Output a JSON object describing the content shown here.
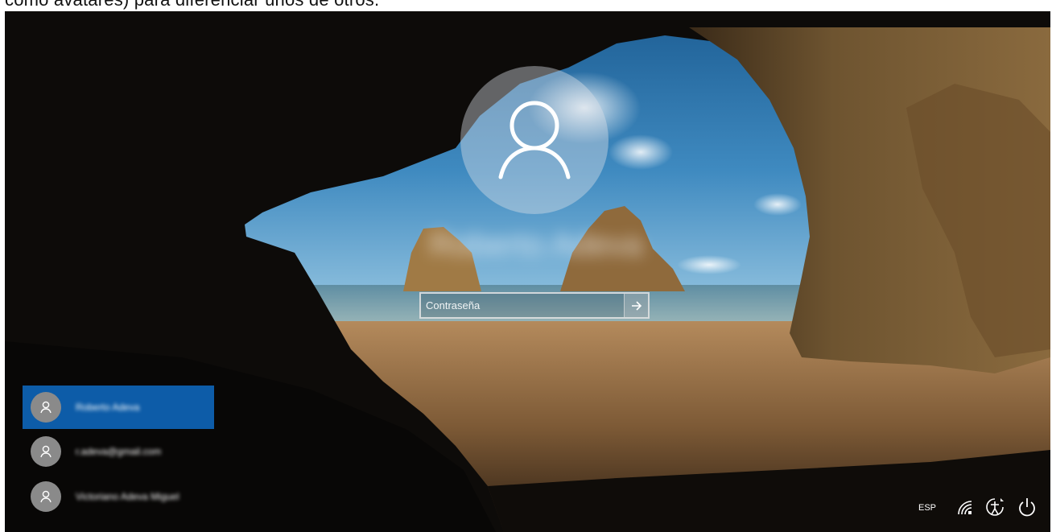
{
  "caption": {
    "text": "como avatares) para diferenciar unos de otros."
  },
  "lock_screen": {
    "user_name": "Roberto Adeva",
    "password_placeholder": "Contraseña",
    "users": [
      {
        "label": "Roberto Adeva",
        "active": true
      },
      {
        "label": "r.adeva@gmail.com",
        "active": false
      },
      {
        "label": "Victoriano Adeva Miguel",
        "active": false
      }
    ],
    "tray": {
      "language": "ESP"
    }
  },
  "colors": {
    "selected_user_bg": "#0d5ca8",
    "mini_avatar_bg": "#8a8a8a",
    "avatar_circle": "rgba(220,225,230,0.42)"
  },
  "icons": {
    "avatar": "user-silhouette-icon",
    "submit": "arrow-right-icon",
    "network": "wifi-icon",
    "accessibility": "ease-of-access-icon",
    "power": "power-icon"
  }
}
